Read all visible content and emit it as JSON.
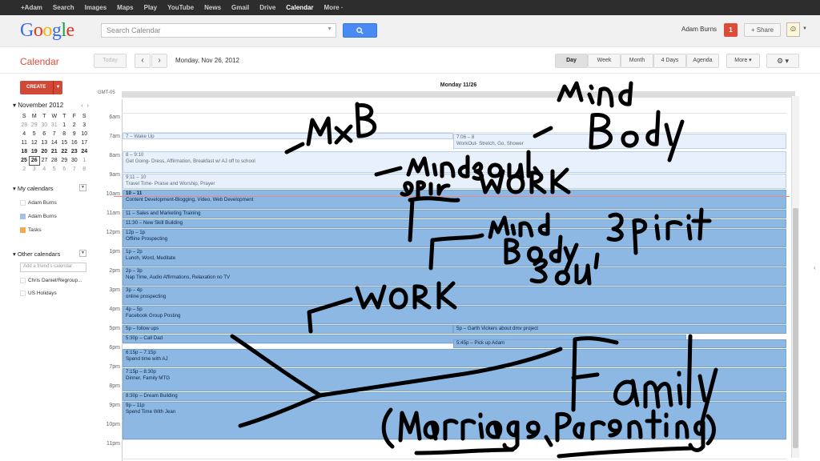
{
  "topbar": [
    "+Adam",
    "Search",
    "Images",
    "Maps",
    "Play",
    "YouTube",
    "News",
    "Gmail",
    "Drive",
    "Calendar",
    "More ·"
  ],
  "header": {
    "search_placeholder": "Search Calendar",
    "user_name": "Adam Burns",
    "notifications": "1",
    "share_label": "+ Share"
  },
  "toolbar": {
    "app_title": "Calendar",
    "today_label": "Today",
    "prev_label": "‹",
    "next_label": "›",
    "date_label": "Monday, Nov 26, 2012",
    "views": [
      "Day",
      "Week",
      "Month",
      "4 Days",
      "Agenda"
    ],
    "more_label": "More ▾",
    "settings_label": "⚙ ▾"
  },
  "sidebar": {
    "create_label": "CREATE",
    "mini_month": "November 2012",
    "weekdays": [
      "S",
      "M",
      "T",
      "W",
      "T",
      "F",
      "S"
    ],
    "weeks": [
      [
        "28",
        "29",
        "30",
        "31",
        "1",
        "2",
        "3"
      ],
      [
        "4",
        "5",
        "6",
        "7",
        "8",
        "9",
        "10"
      ],
      [
        "11",
        "12",
        "13",
        "14",
        "15",
        "16",
        "17"
      ],
      [
        "18",
        "19",
        "20",
        "21",
        "22",
        "23",
        "24"
      ],
      [
        "25",
        "26",
        "27",
        "28",
        "29",
        "30",
        "1"
      ],
      [
        "2",
        "3",
        "4",
        "5",
        "6",
        "7",
        "8"
      ]
    ],
    "my_calendars_label": "My calendars",
    "my_calendars": [
      {
        "name": "Adam Burns",
        "color": "#ffffff"
      },
      {
        "name": "Adam Burns",
        "color": "#a4c2e6"
      },
      {
        "name": "Tasks",
        "color": "#f8a84a"
      }
    ],
    "other_calendars_label": "Other calendars",
    "add_friend_placeholder": "Add a friend's calendar",
    "other_calendars": [
      "Chris Daniel/Regroup...",
      "US Holidays"
    ]
  },
  "grid": {
    "timezone": "GMT-05",
    "day_header": "Monday 11/26",
    "hours": [
      "6am",
      "7am",
      "8am",
      "9am",
      "10am",
      "11am",
      "12pm",
      "1pm",
      "2pm",
      "3pm",
      "4pm",
      "5pm",
      "6pm",
      "7pm",
      "8pm",
      "9pm",
      "10pm",
      "11pm"
    ],
    "events": [
      {
        "time": "7 – Wake Up",
        "title": ""
      },
      {
        "time": "7:06 – 8",
        "title": "WorkOut- Stretch, Go, Shower"
      },
      {
        "time": "8 – 9:10",
        "title": "Get Going- Dress, Affirmation, Breakfast w/ AJ off to school"
      },
      {
        "time": "9:11 – 10",
        "title": "Travel Time- Praise and Worship, Prayer"
      },
      {
        "time": "10 – 11",
        "title": "Content Development-Blogging, Video, Web Development"
      },
      {
        "time": "11 – Sales and Marketing Training",
        "title": ""
      },
      {
        "time": "11:30 – New Skill Building",
        "title": ""
      },
      {
        "time": "12p – 1p",
        "title": "Offline Prospecting"
      },
      {
        "time": "1p – 2p",
        "title": "Lunch, Word, Meditate"
      },
      {
        "time": "2p – 3p",
        "title": "Nap Time, Audio Affirmations, Relaxation no TV"
      },
      {
        "time": "3p – 4p",
        "title": "online prospecting"
      },
      {
        "time": "4p – 5p",
        "title": "Facebook Group Posting"
      },
      {
        "time": "5p – follow ups",
        "title": ""
      },
      {
        "time": "5p – Garth Vickers about dmv project",
        "title": ""
      },
      {
        "time": "5:30p – Call Dad",
        "title": ""
      },
      {
        "time": "5:45p – Pick up Adam",
        "title": ""
      },
      {
        "time": "6:15p – 7:15p",
        "title": "Spend time with AJ"
      },
      {
        "time": "7:15p – 8:30p",
        "title": "Dinner, Family MTG"
      },
      {
        "time": "8:30p – Dream Building",
        "title": ""
      },
      {
        "time": "9p – 11p",
        "title": "Spend Time With Jean"
      }
    ]
  },
  "colors": {
    "event": "#8cb8e3",
    "event_light": "#e8f1fb",
    "ink": "#000000",
    "create": "#d14836",
    "app_title": "#dd4b39"
  }
}
